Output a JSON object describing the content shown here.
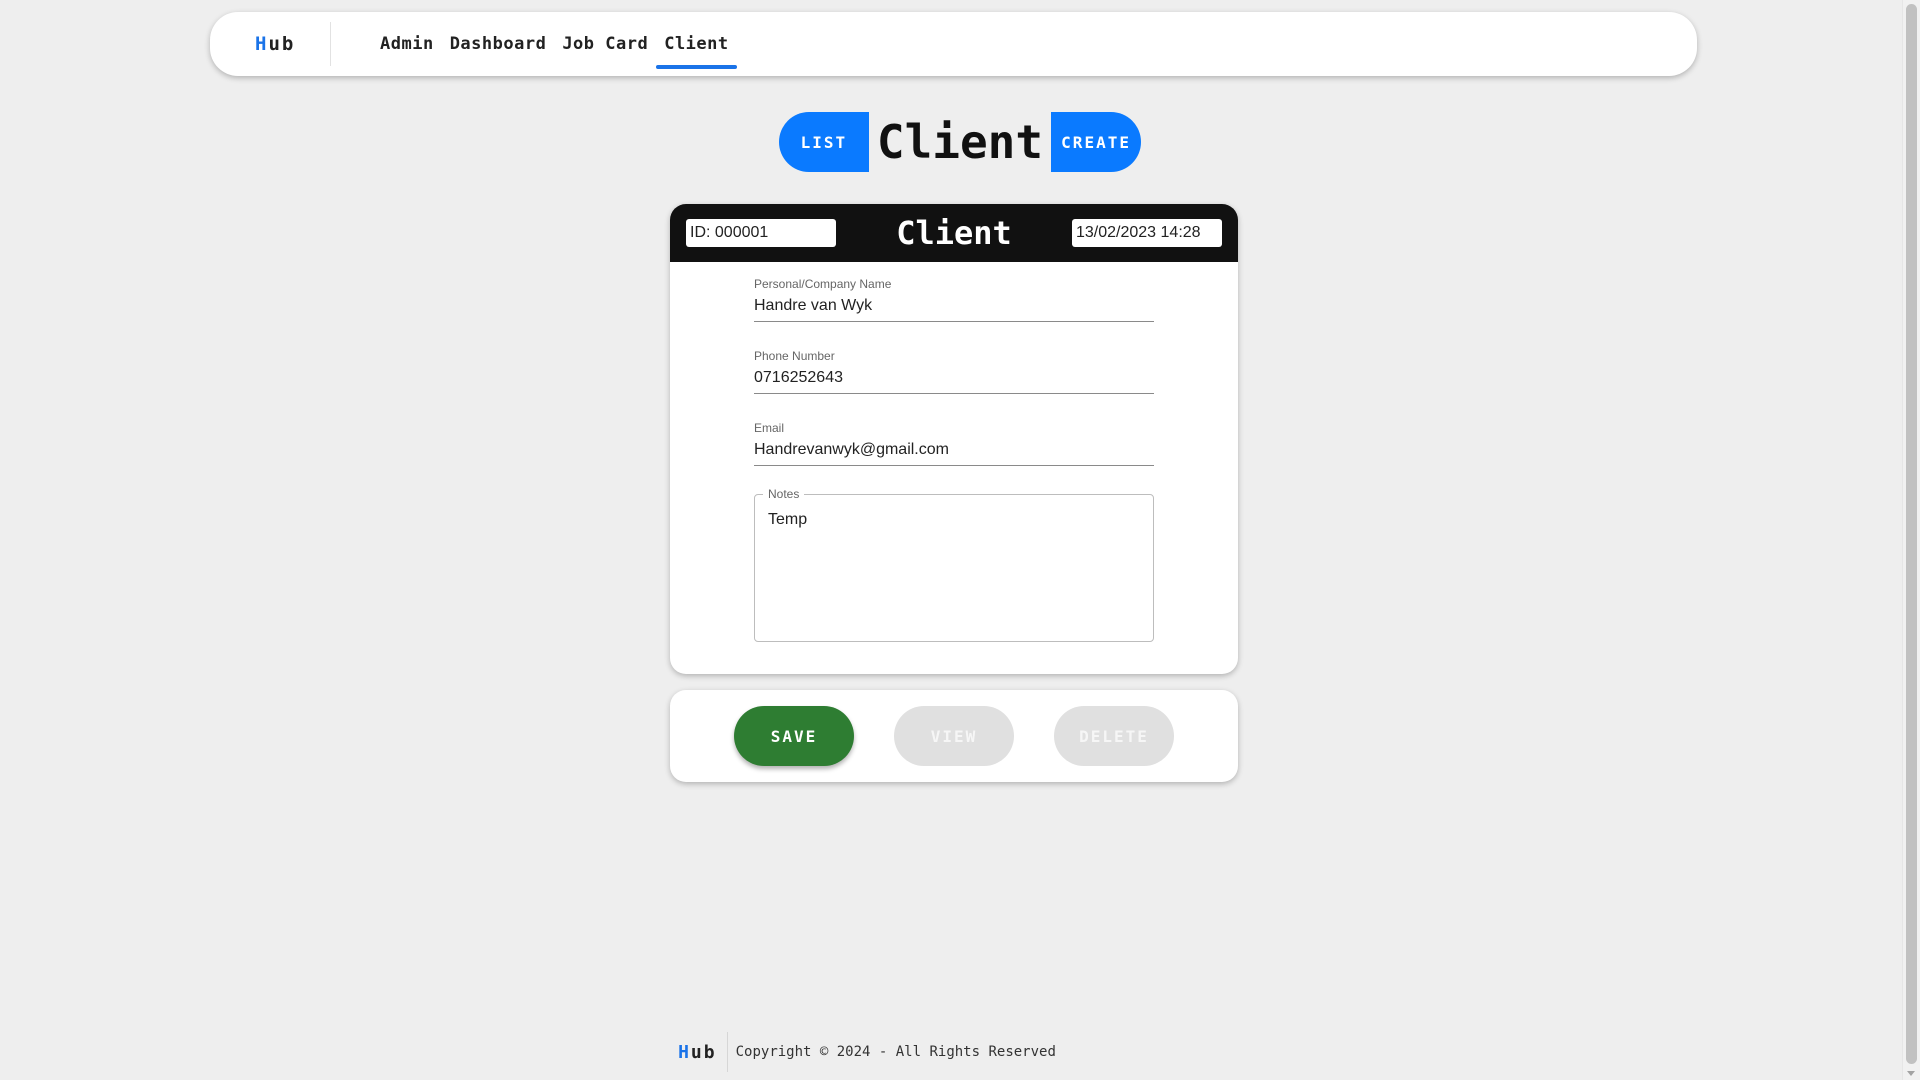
{
  "navbar": {
    "brand_first": "H",
    "brand_rest": "ub",
    "links": [
      {
        "label": "Admin"
      },
      {
        "label": "Dashboard"
      },
      {
        "label": "Job Card"
      },
      {
        "label": "Client"
      }
    ],
    "active_link": "Client",
    "theme_icon": "moon-icon"
  },
  "title_row": {
    "list_label": "LIST",
    "title": "Client",
    "create_label": "CREATE"
  },
  "form": {
    "id_value": "ID: 000001",
    "header_title": "Client",
    "date_value": "13/02/2023 14:28",
    "fields": {
      "name": {
        "label": "Personal/Company Name",
        "value": "Handre van Wyk"
      },
      "phone": {
        "label": "Phone Number",
        "value": "0716252643"
      },
      "email": {
        "label": "Email",
        "value": "Handrevanwyk@gmail.com"
      },
      "notes": {
        "label": "Notes",
        "value": "Temp"
      }
    }
  },
  "actions": {
    "save_label": "SAVE",
    "view_label": "VIEW",
    "delete_label": "DELETE"
  },
  "footer": {
    "brand_first": "H",
    "brand_rest": "ub",
    "copyright": "Copyright © 2024 - All Rights Reserved"
  },
  "colors": {
    "accent_blue": "#0a7aff",
    "save_green": "#2e7d32",
    "disabled_grey": "#e0e0e0",
    "header_black": "#111111",
    "background": "#eeeeee"
  }
}
